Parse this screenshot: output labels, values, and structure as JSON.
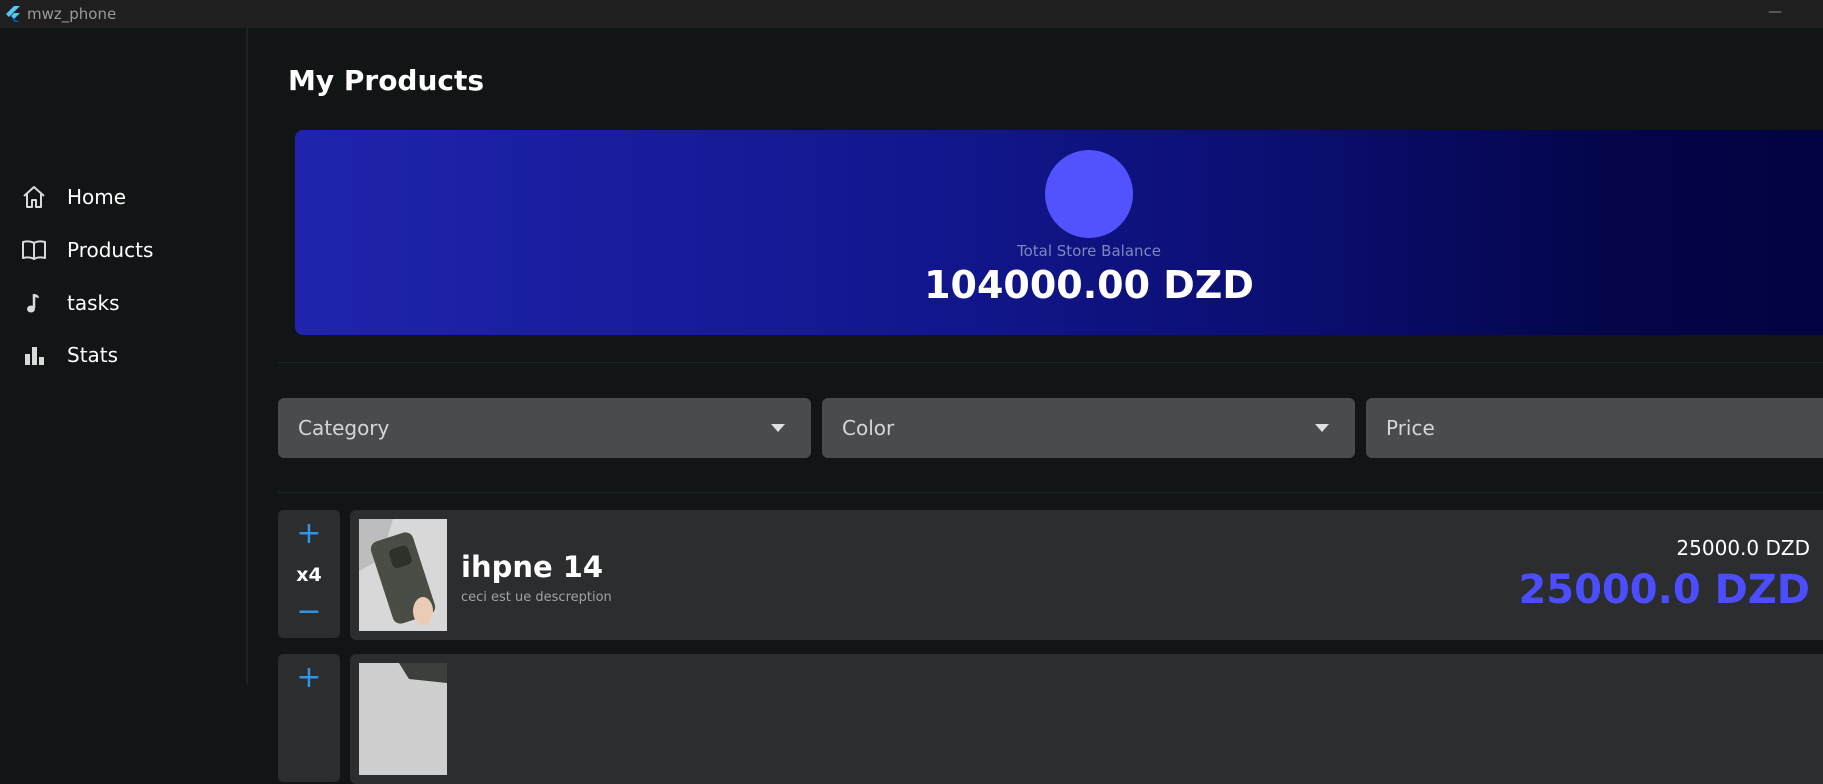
{
  "window": {
    "title": "mwz_phone",
    "minimize_label": "—"
  },
  "sidebar": {
    "items": [
      {
        "label": "Home",
        "icon": "home-icon"
      },
      {
        "label": "Products",
        "icon": "book-icon"
      },
      {
        "label": "tasks",
        "icon": "music-note-icon"
      },
      {
        "label": "Stats",
        "icon": "bar-chart-icon"
      }
    ]
  },
  "page": {
    "title": "My Products"
  },
  "balance": {
    "label": "Total Store Balance",
    "value": "104000.00 DZD",
    "circle_color": "#5253ff"
  },
  "filters": [
    {
      "label": "Category",
      "has_dropdown": true
    },
    {
      "label": "Color",
      "has_dropdown": true
    },
    {
      "label": "Price",
      "has_dropdown": false
    }
  ],
  "products": [
    {
      "quantity": "x4",
      "plus": "+",
      "minus": "−",
      "name": "ihpne 14",
      "description": "ceci est ue descreption",
      "unit_price": "25000.0 DZD",
      "total_price": "25000.0 DZD"
    },
    {
      "plus": "+"
    }
  ],
  "colors": {
    "accent": "#2b95e6",
    "price": "#4b4dff",
    "background": "#121516",
    "card": "#2b2d2f",
    "filter": "#4a4b4d"
  }
}
